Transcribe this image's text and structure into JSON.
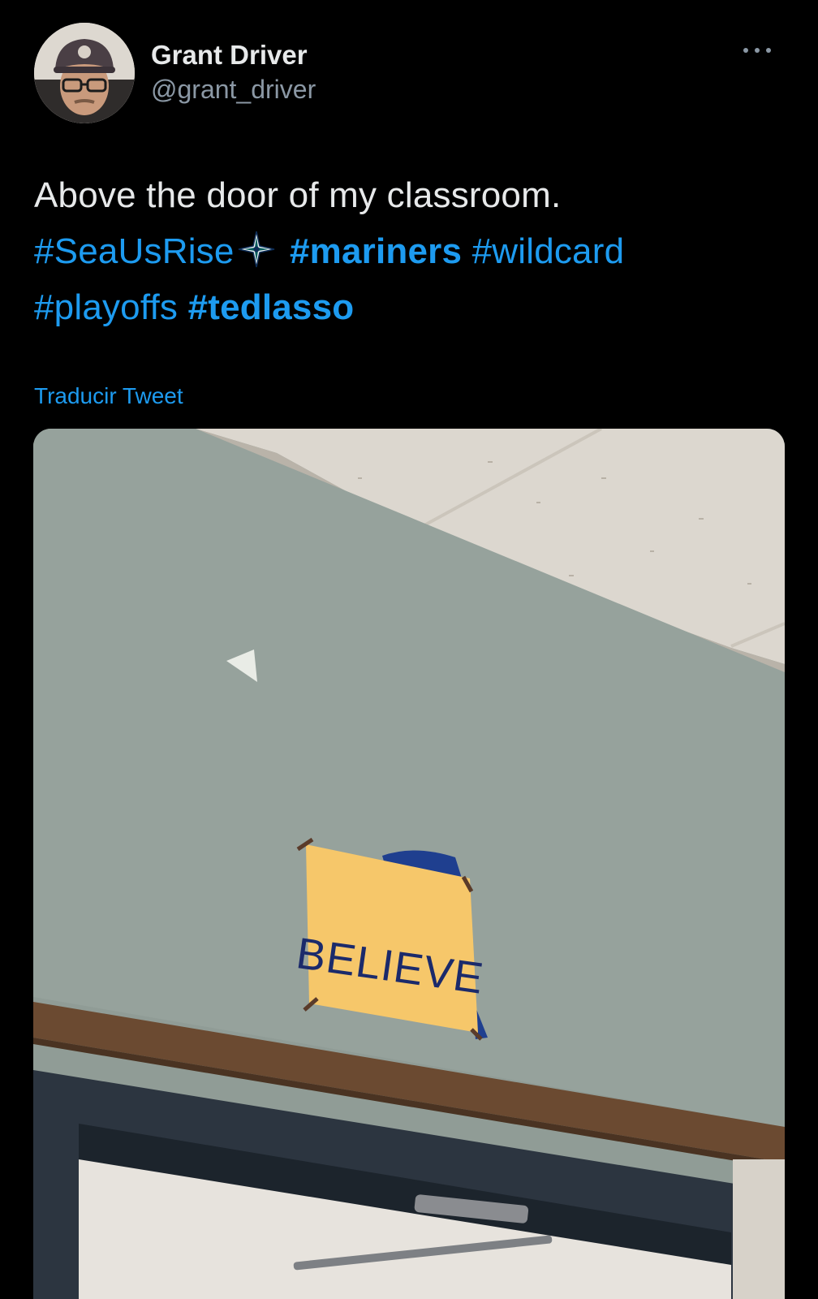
{
  "author": {
    "display_name": "Grant Driver",
    "handle": "@grant_driver",
    "avatar_icon": "profile-photo"
  },
  "more_icon": "more-horizontal-icon",
  "tweet": {
    "text_plain": "Above the door of my classroom.",
    "hashtags": [
      "#SeaUsRise",
      "#mariners",
      "#wildcard",
      "#playoffs",
      "#tedlasso"
    ],
    "emoji": "mariners-compass-emoji"
  },
  "translate_label": "Traducir Tweet",
  "media": {
    "sign_text": "BELIEVE",
    "alt": "photo"
  },
  "colors": {
    "background": "#000000",
    "text": "#e7e9ea",
    "secondary": "#8b98a5",
    "link": "#1d9bf0"
  }
}
